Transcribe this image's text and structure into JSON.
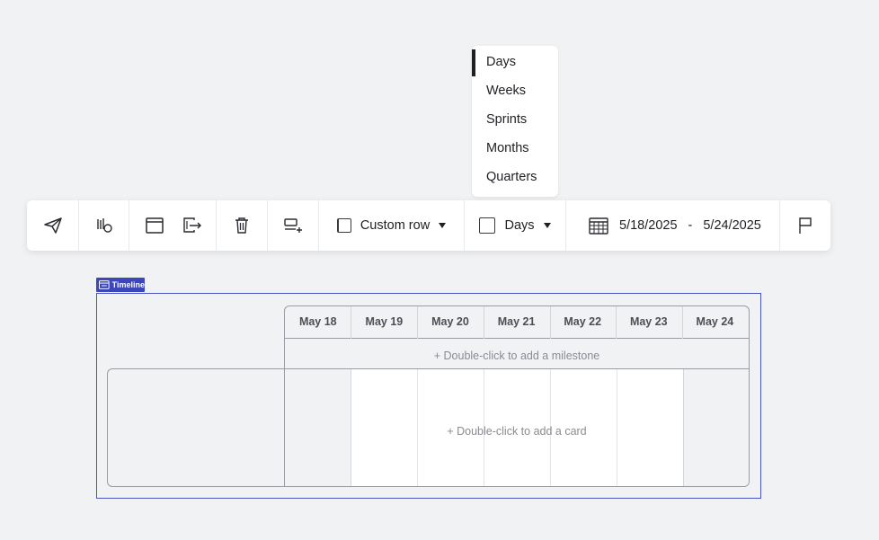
{
  "dropdown": {
    "items": [
      {
        "label": "Days",
        "selected": true
      },
      {
        "label": "Weeks",
        "selected": false
      },
      {
        "label": "Sprints",
        "selected": false
      },
      {
        "label": "Months",
        "selected": false
      },
      {
        "label": "Quarters",
        "selected": false
      }
    ]
  },
  "toolbar": {
    "row_type_label": "Custom row",
    "scale_label": "Days",
    "date_start": "5/18/2025",
    "date_separator": "-",
    "date_end": "5/24/2025",
    "icons": [
      "send-icon",
      "hand-pointer-icon",
      "window-icon",
      "export-icon",
      "trash-icon",
      "add-row-icon",
      "row-color-swatch",
      "scale-swatch",
      "calendar-icon",
      "flag-icon"
    ]
  },
  "timeline": {
    "tag_label": "Timeline",
    "days": [
      "May 18",
      "May 19",
      "May 20",
      "May 21",
      "May 22",
      "May 23",
      "May 24"
    ],
    "milestone_hint": "+ Double-click to add a milestone",
    "card_hint": "+ Double-click to add a card"
  },
  "colors": {
    "accent": "#3c46b9",
    "weekend_bg": "#f1f2f4",
    "weekday_bg": "#ffffff"
  }
}
